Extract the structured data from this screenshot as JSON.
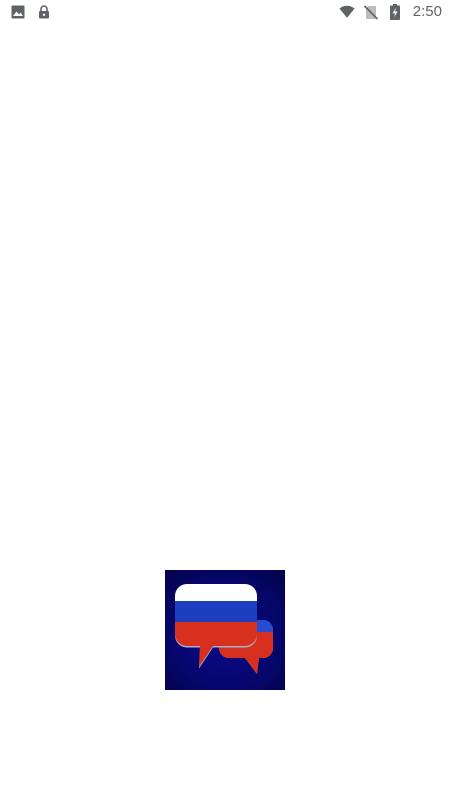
{
  "status_bar": {
    "time": "2:50",
    "left_icons": [
      "image-notification-icon",
      "lock-notification-icon"
    ],
    "right_icons": [
      "wifi-icon",
      "no-sim-icon",
      "battery-charging-icon"
    ]
  },
  "splash": {
    "logo": "russian-flag-chat-bubbles-logo",
    "colors": {
      "background": "#06066f",
      "white": "#ffffff",
      "blue": "#1d3fbf",
      "red": "#d8301f"
    }
  }
}
